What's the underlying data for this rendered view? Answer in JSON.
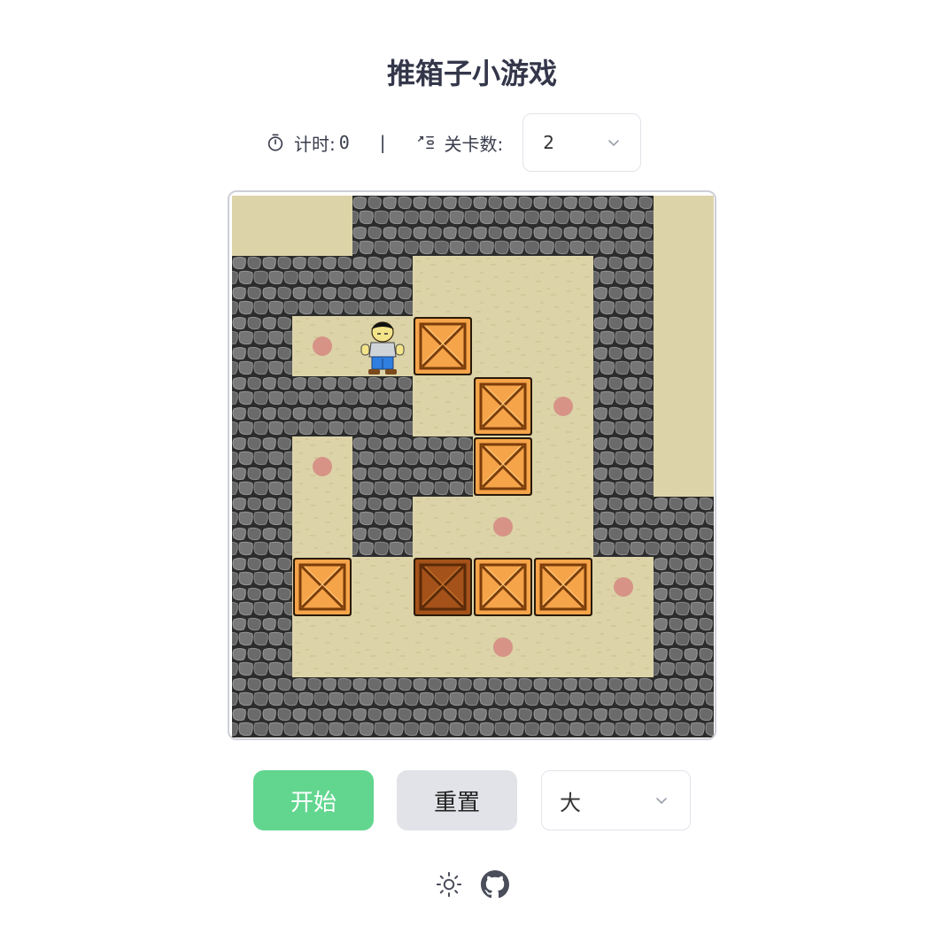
{
  "title": "推箱子小游戏",
  "status": {
    "timer_label": "计时:",
    "timer_value": "0",
    "separator": "|",
    "level_label": "关卡数:",
    "level_value": "2"
  },
  "controls": {
    "start_label": "开始",
    "reset_label": "重置",
    "size_value": "大"
  },
  "colors": {
    "start_button": "#62d68f",
    "reset_button": "#e1e3e8",
    "floor": "#dcd3a8",
    "wall": "#6e6e6e",
    "target": "#d69386",
    "box": "#f6a44a",
    "box_on_target": "#a4521a"
  },
  "icons": {
    "timer": "stopwatch-icon",
    "level": "level-steps-icon",
    "theme": "sun-icon",
    "repo": "github-icon",
    "dropdown": "chevron-down-icon"
  },
  "board": {
    "legend": {
      "#": "wall",
      ".": "floor",
      "o": "target",
      "B": "box",
      "*": "box-on-target",
      "@": "player",
      "_": "empty"
    },
    "rows": [
      "__#####_",
      "###...#_",
      "#o@B..#_",
      "###.Bo#_",
      "#o##B.#_",
      "#.#.o.##",
      "#B.*BBo#",
      "#...o..#",
      "########"
    ]
  }
}
